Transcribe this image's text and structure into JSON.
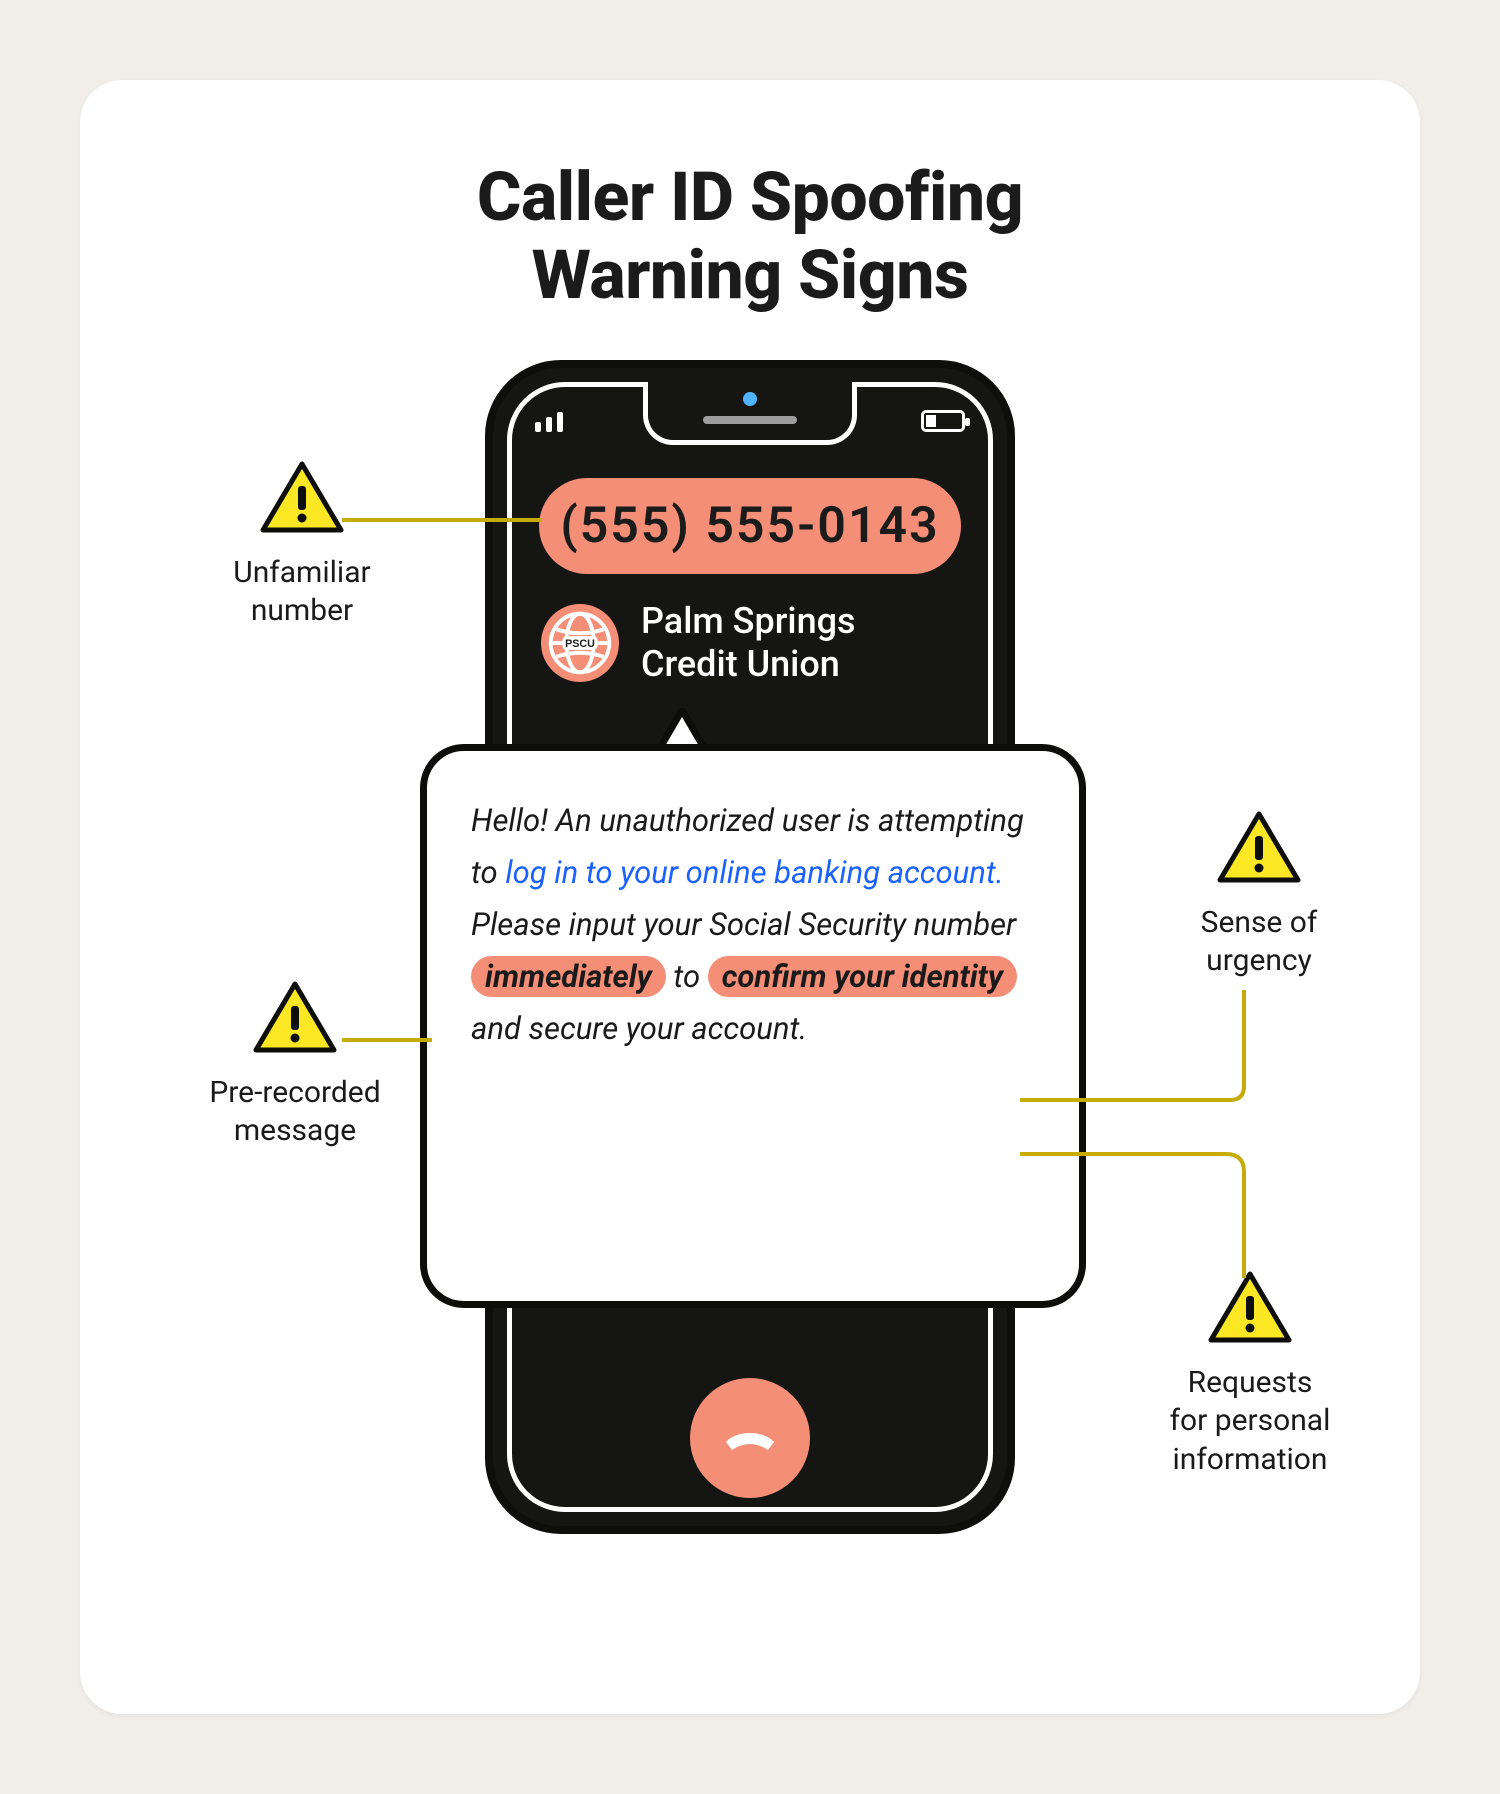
{
  "title_line1": "Caller ID Spoofing",
  "title_line2": "Warning Signs",
  "phone": {
    "number": "(555) 555-0143",
    "caller_name_line1": "Palm Springs",
    "caller_name_line2": "Credit Union",
    "logo_text": "PSCU"
  },
  "transcript": {
    "t1": "Hello! An unauthorized user is attempting to ",
    "link": "log in to your online banking account.",
    "t2": " Please input your Social Security number ",
    "hl1": "immediately",
    "t3": " to ",
    "hl2": "confirm your identity",
    "t4": " and secure your account."
  },
  "callouts": {
    "unfamiliar_l1": "Unfamiliar",
    "unfamiliar_l2": "number",
    "prerecorded_l1": "Pre-recorded",
    "prerecorded_l2": "message",
    "urgency_l1": "Sense of",
    "urgency_l2": "urgency",
    "requests_l1": "Requests",
    "requests_l2": "for personal",
    "requests_l3": "information"
  }
}
